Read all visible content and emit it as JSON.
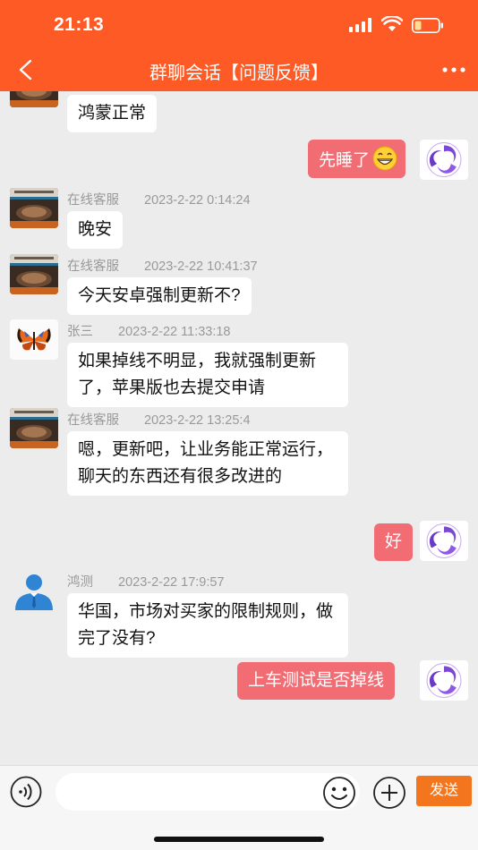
{
  "status_bar": {
    "time": "21:13"
  },
  "nav": {
    "title": "群聊会话【问题反馈】"
  },
  "messages": [
    {
      "text": "鸿蒙正常"
    },
    {
      "text": "先睡了"
    },
    {
      "sender": "在线客服",
      "time": "2023-2-22 0:14:24",
      "text": "晚安"
    },
    {
      "sender": "在线客服",
      "time": "2023-2-22 10:41:37",
      "text": "今天安卓强制更新不?"
    },
    {
      "sender": "张三",
      "time": "2023-2-22 11:33:18",
      "text": "如果掉线不明显，我就强制更新了，苹果版也去提交申请"
    },
    {
      "sender": "在线客服",
      "time": "2023-2-22 13:25:4",
      "text": "嗯，更新吧，让业务能正常运行，聊天的东西还有很多改进的"
    },
    {
      "text": "好"
    },
    {
      "sender": "鸿测",
      "time": "2023-2-22 17:9:57",
      "text": "华国，市场对买家的限制规则，做完了没有?"
    },
    {
      "text": "上车测试是否掉线"
    }
  ],
  "input_bar": {
    "send_label": "发送"
  },
  "colors": {
    "header": "#fd5a25",
    "outgoing_bubble": "#f26c74",
    "send_button": "#f3761f",
    "background": "#ececec"
  },
  "icons": [
    "back-arrow-icon",
    "more-icon",
    "voice-icon",
    "emoji-icon",
    "plus-icon",
    "grin-emoji-icon"
  ]
}
